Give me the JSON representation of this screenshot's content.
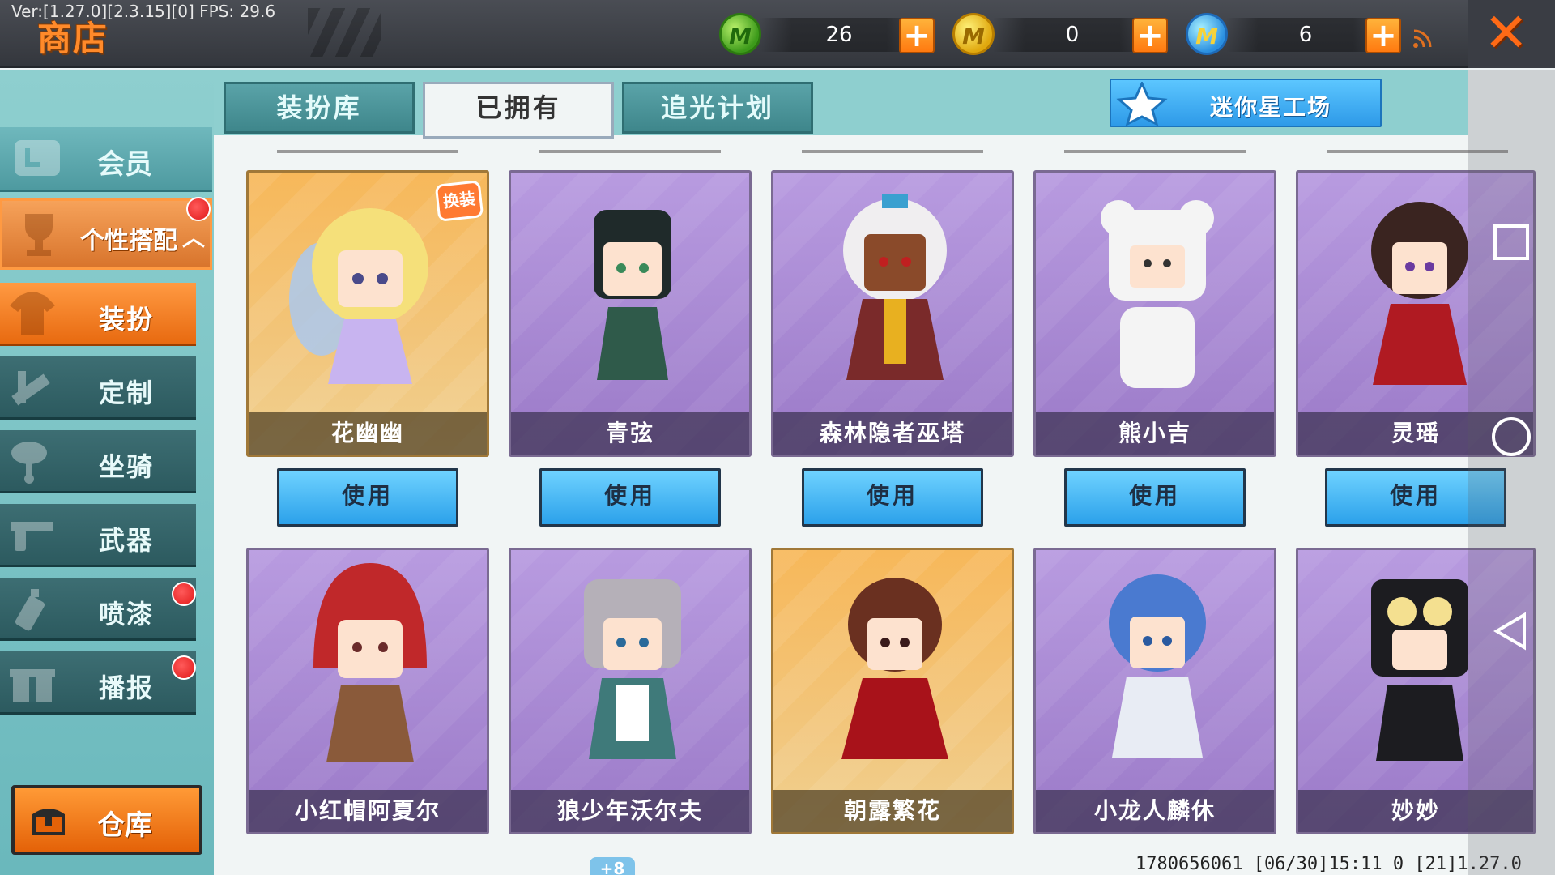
{
  "debug": "Ver:[1.27.0][2.3.15][0] FPS: 29.6",
  "header": {
    "title": "商店",
    "currencies": [
      {
        "icon": "green-m-coin-icon",
        "amount": "26"
      },
      {
        "icon": "gold-m-coin-icon",
        "amount": "0"
      },
      {
        "icon": "blue-m-coin-icon",
        "amount": "6"
      }
    ],
    "plus_label": "+"
  },
  "sidebar": {
    "member": "会员",
    "personal": "个性搭配",
    "items": [
      {
        "label": "装扮"
      },
      {
        "label": "定制"
      },
      {
        "label": "坐骑"
      },
      {
        "label": "武器"
      },
      {
        "label": "喷漆"
      },
      {
        "label": "播报"
      }
    ],
    "warehouse": "仓库"
  },
  "tabs": [
    {
      "label": "装扮库"
    },
    {
      "label": "已拥有"
    },
    {
      "label": "追光计划"
    }
  ],
  "studio_button": "迷你星工场",
  "swap_badge": "换装",
  "use_label": "使用",
  "cards": [
    {
      "name": "花幽幽"
    },
    {
      "name": "青弦"
    },
    {
      "name": "森林隐者巫塔"
    },
    {
      "name": "熊小吉"
    },
    {
      "name": "灵瑶"
    },
    {
      "name": "小红帽阿夏尔"
    },
    {
      "name": "狼少年沃尔夫"
    },
    {
      "name": "朝露繁花"
    },
    {
      "name": "小龙人麟休"
    },
    {
      "name": "妙妙"
    }
  ],
  "footer": {
    "info": "1780656061   [06/30]15:11 0   [21]1.27.0",
    "page_tab": "+8"
  },
  "colors": {
    "accent_orange": "#ff8a2a",
    "use_button_blue": "#2ba1ea",
    "sidebar_teal": "#3d6e73"
  }
}
